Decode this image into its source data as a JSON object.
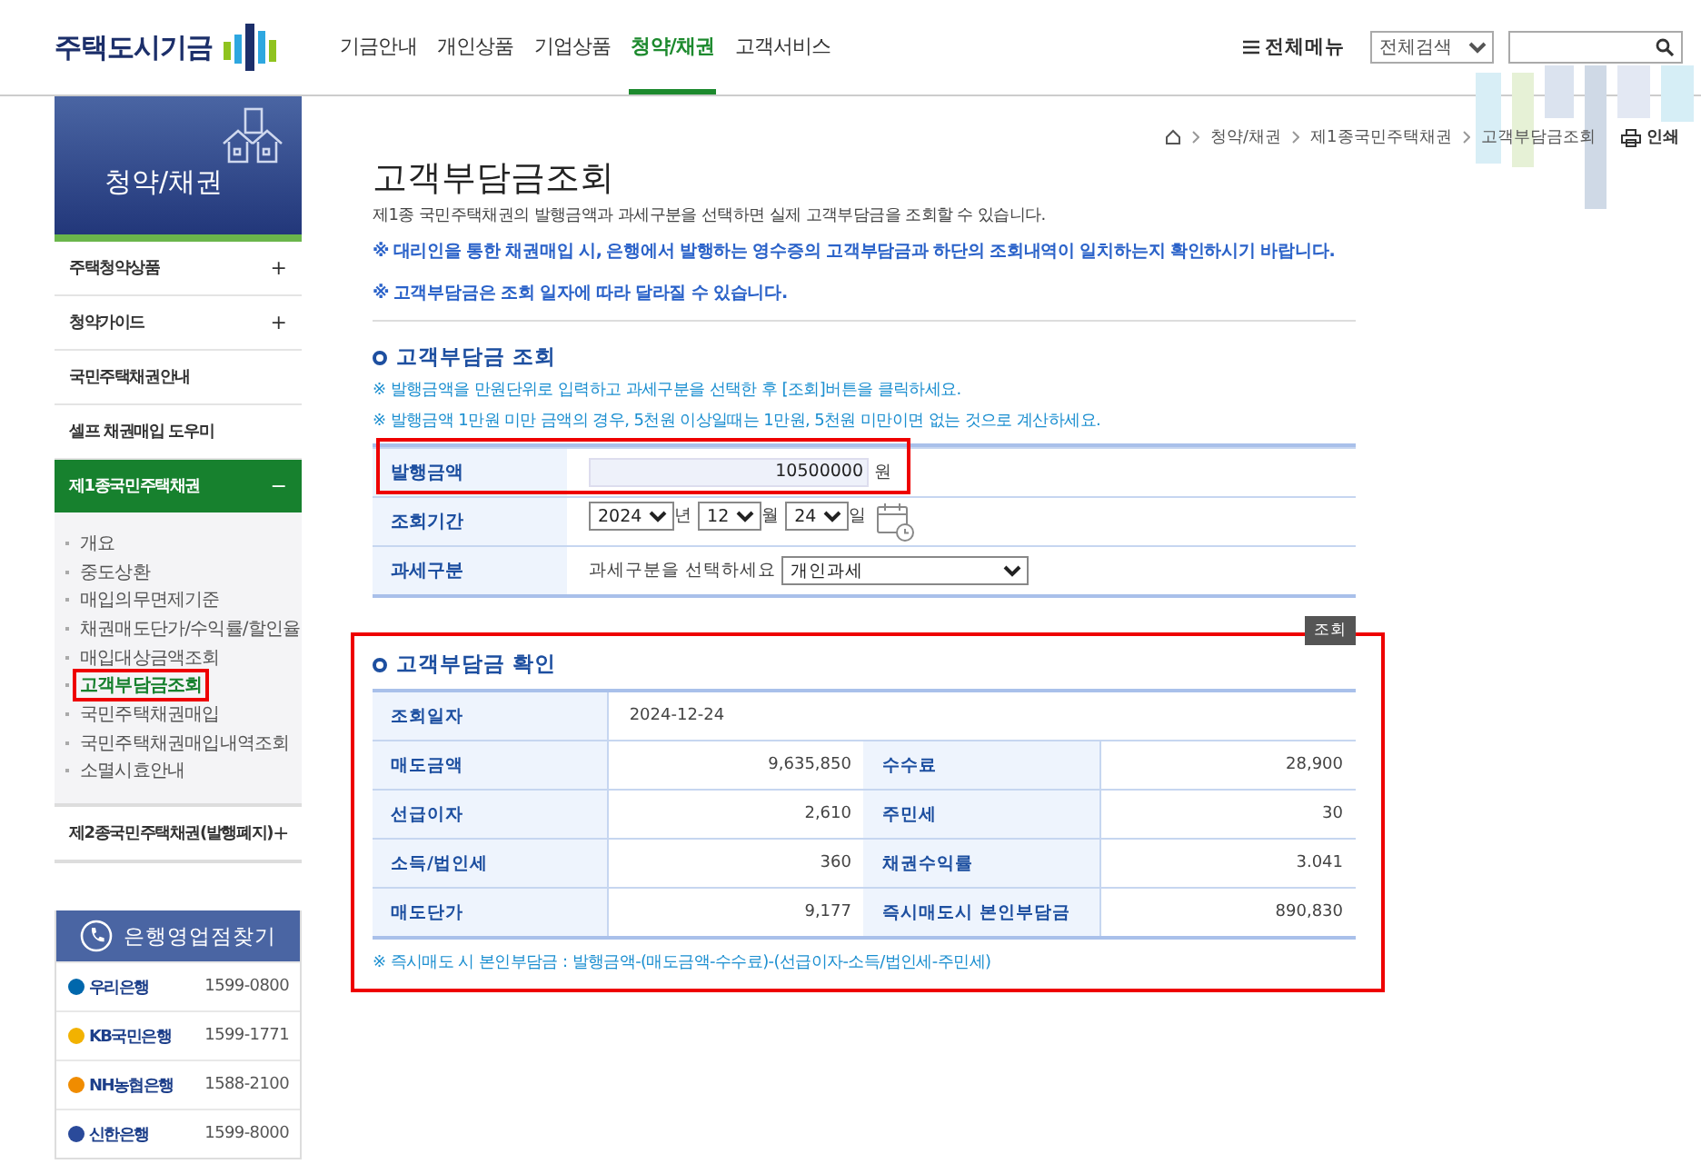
{
  "header": {
    "logo": "주택도시기금",
    "nav": [
      {
        "label": "기금안내",
        "selected": false
      },
      {
        "label": "개인상품",
        "selected": false
      },
      {
        "label": "기업상품",
        "selected": false
      },
      {
        "label": "청약/채권",
        "selected": true
      },
      {
        "label": "고객서비스",
        "selected": false
      }
    ],
    "all_menu": "전체메뉴",
    "search_scope": "전체검색"
  },
  "sidebar": {
    "title": "청약/채권",
    "items": [
      {
        "label": "주택청약상품",
        "toggle": "+",
        "expanded": false
      },
      {
        "label": "청약가이드",
        "toggle": "+",
        "expanded": false
      },
      {
        "label": "국민주택채권안내",
        "expanded": false
      },
      {
        "label": "셀프 채권매입 도우미",
        "expanded": false
      },
      {
        "label": "제1종국민주택채권",
        "toggle": "−",
        "expanded": true,
        "children": [
          {
            "label": "개요",
            "selected": false,
            "highlighted": false
          },
          {
            "label": "중도상환",
            "selected": false,
            "highlighted": false
          },
          {
            "label": "매입의무면제기준",
            "selected": false,
            "highlighted": false
          },
          {
            "label": "채권매도단가/수익률/할인율",
            "selected": false,
            "highlighted": false
          },
          {
            "label": "매입대상금액조회",
            "selected": false,
            "highlighted": false
          },
          {
            "label": "고객부담금조회",
            "selected": true,
            "highlighted": true
          },
          {
            "label": "국민주택채권매입",
            "selected": false,
            "highlighted": false
          },
          {
            "label": "국민주택채권매입내역조회",
            "selected": false,
            "highlighted": false
          },
          {
            "label": "소멸시효안내",
            "selected": false,
            "highlighted": false
          }
        ]
      },
      {
        "label": "제2종국민주택채권(발행폐지)",
        "toggle": "+",
        "expanded": false
      }
    ],
    "bank_finder": {
      "title": "은행영업점찾기",
      "banks": [
        {
          "name": "우리은행",
          "phone": "1599-0800",
          "color": "#0067ac"
        },
        {
          "name": "KB국민은행",
          "phone": "1599-1771",
          "color": "#f2b200"
        },
        {
          "name": "NH농협은행",
          "phone": "1588-2100",
          "color": "#f08c00"
        },
        {
          "name": "신한은행",
          "phone": "1599-8000",
          "color": "#2a4a9a"
        }
      ]
    }
  },
  "breadcrumb": [
    "청약/채권",
    "제1종국민주택채권",
    "고객부담금조회"
  ],
  "print": "인쇄",
  "page": {
    "title": "고객부담금조회",
    "description": "제1종 국민주택채권의 발행금액과 과세구분을 선택하면 실제 고객부담금을 조회할 수 있습니다.",
    "notices": [
      "※ 대리인을 통한 채권매입 시, 은행에서 발행하는 영수증의 고객부담금과 하단의 조회내역이 일치하는지 확인하시기 바랍니다.",
      "※ 고객부담금은 조회 일자에 따라 달라질 수 있습니다."
    ]
  },
  "query_section": {
    "title": "고객부담금 조회",
    "notes": [
      "※ 발행금액을 만원단위로 입력하고 과세구분을 선택한 후 [조회]버튼을 클릭하세요.",
      "※ 발행금액 1만원 미만 금액의 경우, 5천원 이상일때는 1만원, 5천원 미만이면 없는 것으로 계산하세요."
    ],
    "fields": [
      {
        "kind": "amount",
        "label": "발행금액",
        "value": "10500000",
        "unit": "원",
        "highlighted": true
      },
      {
        "kind": "date",
        "label": "조회기간",
        "year": "2024",
        "year_unit": "년",
        "month": "12",
        "month_unit": "월",
        "day": "24",
        "day_unit": "일",
        "highlighted": false
      },
      {
        "kind": "select",
        "label": "과세구분",
        "prompt": "과세구분을 선택하세요",
        "value": "개인과세",
        "highlighted": false
      }
    ],
    "button": "조회"
  },
  "result_section": {
    "title": "고객부담금 확인",
    "highlighted": true,
    "date_label": "조회일자",
    "date": "2024-12-24",
    "rows": [
      [
        {
          "label": "매도금액",
          "value": "9,635,850"
        },
        {
          "label": "수수료",
          "value": "28,900"
        }
      ],
      [
        {
          "label": "선급이자",
          "value": "2,610"
        },
        {
          "label": "주민세",
          "value": "30"
        }
      ],
      [
        {
          "label": "소득/법인세",
          "value": "360"
        },
        {
          "label": "채권수익률",
          "value": "3.041"
        }
      ],
      [
        {
          "label": "매도단가",
          "value": "9,177"
        },
        {
          "label": "즉시매도시 본인부담금",
          "value": "890,830"
        }
      ]
    ],
    "formula": "※ 즉시매도 시 본인부담금 : 발행금액-(매도금액-수수료)-(선급이자-소득/법인세-주민세)"
  }
}
